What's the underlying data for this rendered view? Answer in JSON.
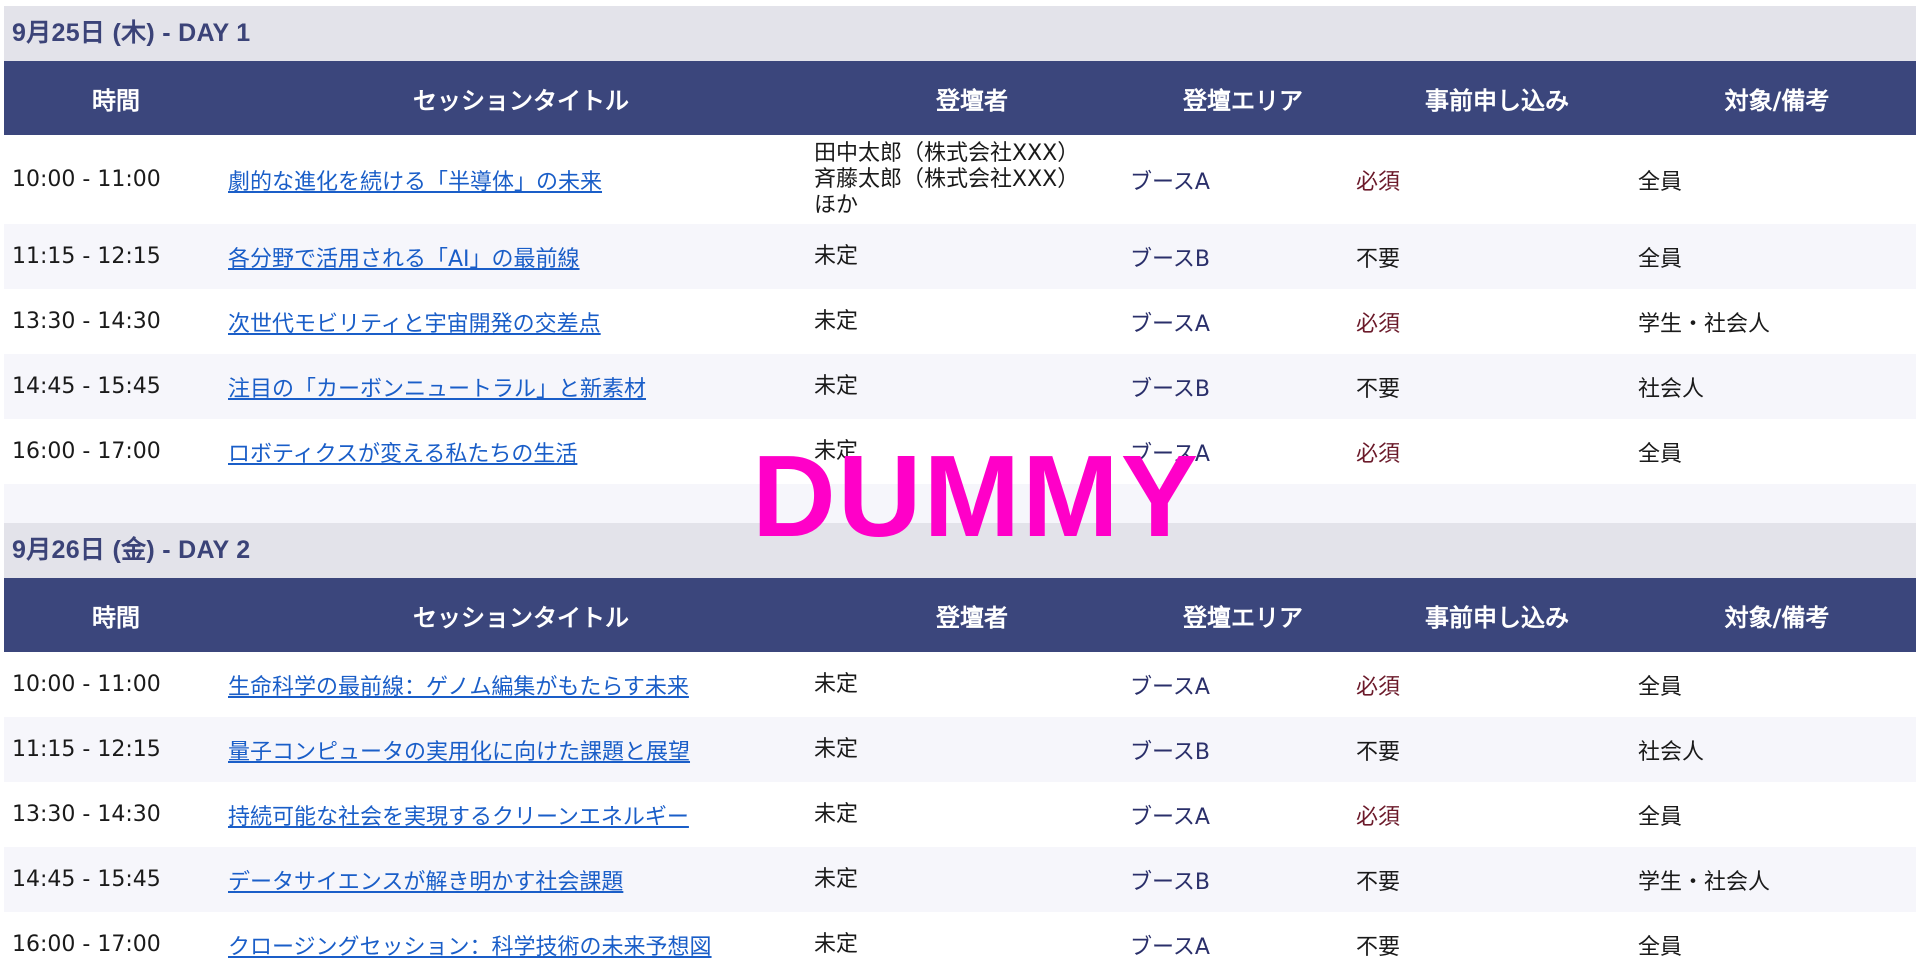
{
  "headers": [
    "時間",
    "セッションタイトル",
    "登壇者",
    "登壇エリア",
    "事前申し込み",
    "対象/備考"
  ],
  "days": [
    {
      "title": "9月25日 (木) - DAY 1",
      "sessions": [
        {
          "time": "10:00 - 11:00",
          "title": "劇的な進化を続ける「半導体」の未来",
          "speaker": [
            "田中太郎（株式会社XXX）",
            "斉藤太郎（株式会社XXX）",
            "ほか"
          ],
          "area": "ブースA",
          "registration": "必須",
          "target": "全員"
        },
        {
          "time": "11:15 - 12:15",
          "title": "各分野で活用される「AI」の最前線",
          "speaker": [
            "未定"
          ],
          "area": "ブースB",
          "registration": "不要",
          "target": "全員"
        },
        {
          "time": "13:30 - 14:30",
          "title": "次世代モビリティと宇宙開発の交差点",
          "speaker": [
            "未定"
          ],
          "area": "ブースA",
          "registration": "必須",
          "target": "学生・社会人"
        },
        {
          "time": "14:45 - 15:45",
          "title": "注目の「カーボンニュートラル」と新素材",
          "speaker": [
            "未定"
          ],
          "area": "ブースB",
          "registration": "不要",
          "target": "社会人"
        },
        {
          "time": "16:00 - 17:00",
          "title": "ロボティクスが変える私たちの生活",
          "speaker": [
            "未定"
          ],
          "area": "ブースA",
          "registration": "必須",
          "target": "全員"
        }
      ]
    },
    {
      "title": "9月26日 (金) - DAY 2",
      "sessions": [
        {
          "time": "10:00 - 11:00",
          "title": "生命科学の最前線：ゲノム編集がもたらす未来",
          "speaker": [
            "未定"
          ],
          "area": "ブースA",
          "registration": "必須",
          "target": "全員"
        },
        {
          "time": "11:15 - 12:15",
          "title": "量子コンピュータの実用化に向けた課題と展望",
          "speaker": [
            "未定"
          ],
          "area": "ブースB",
          "registration": "不要",
          "target": "社会人"
        },
        {
          "time": "13:30 - 14:30",
          "title": "持続可能な社会を実現するクリーンエネルギー",
          "speaker": [
            "未定"
          ],
          "area": "ブースA",
          "registration": "必須",
          "target": "全員"
        },
        {
          "time": "14:45 - 15:45",
          "title": "データサイエンスが解き明かす社会課題",
          "speaker": [
            "未定"
          ],
          "area": "ブースB",
          "registration": "不要",
          "target": "学生・社会人"
        },
        {
          "time": "16:00 - 17:00",
          "title": "クロージングセッション：科学技術の未来予想図",
          "speaker": [
            "未定"
          ],
          "area": "ブースA",
          "registration": "不要",
          "target": "全員"
        }
      ]
    }
  ],
  "watermark": "DUMMY",
  "colors": {
    "header_bg": "#3b467c",
    "day_header_bg": "#e3e3ea",
    "day_header_text": "#3b4378",
    "link": "#1a5ec8",
    "watermark": "#ff00c8"
  }
}
